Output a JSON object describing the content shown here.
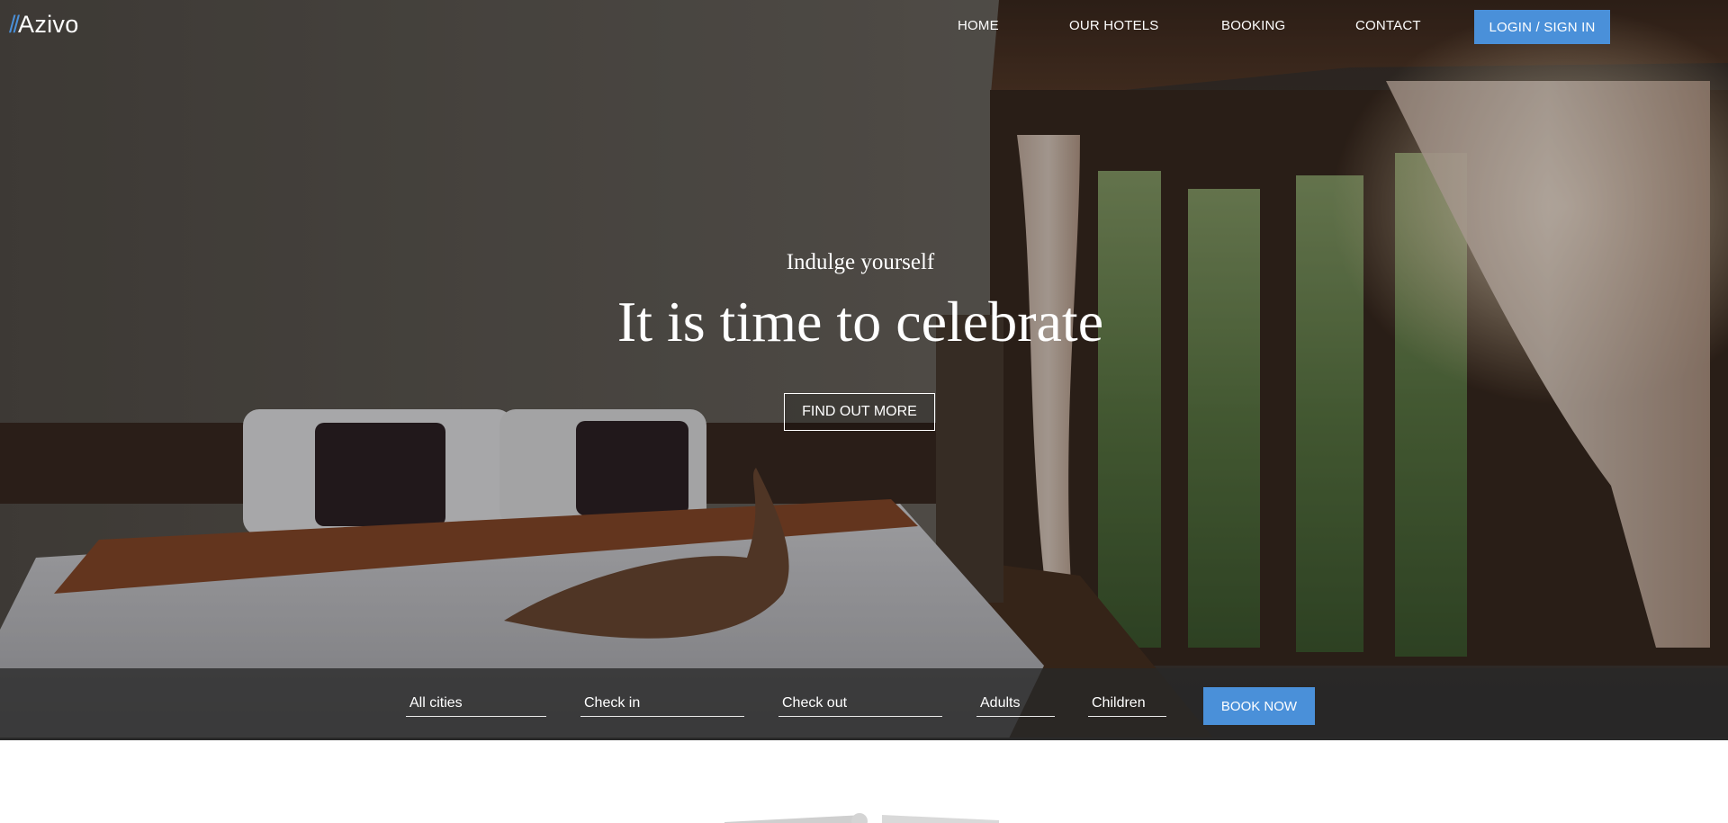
{
  "brand": {
    "slashes": "//",
    "name": "Azivo",
    "accent": "#4a90d9"
  },
  "nav": {
    "links": [
      {
        "label": "HOME"
      },
      {
        "label": "OUR HOTELS"
      },
      {
        "label": "BOOKING"
      },
      {
        "label": "CONTACT"
      }
    ],
    "login_label": "LOGIN / SIGN IN"
  },
  "hero": {
    "eyebrow": "Indulge yourself",
    "headline": "It is time to celebrate",
    "cta_label": "FIND OUT MORE"
  },
  "booking": {
    "city": "All cities",
    "check_in": "Check in",
    "check_out": "Check out",
    "adults": "Adults",
    "children": "Children",
    "book_label": "BOOK NOW"
  }
}
